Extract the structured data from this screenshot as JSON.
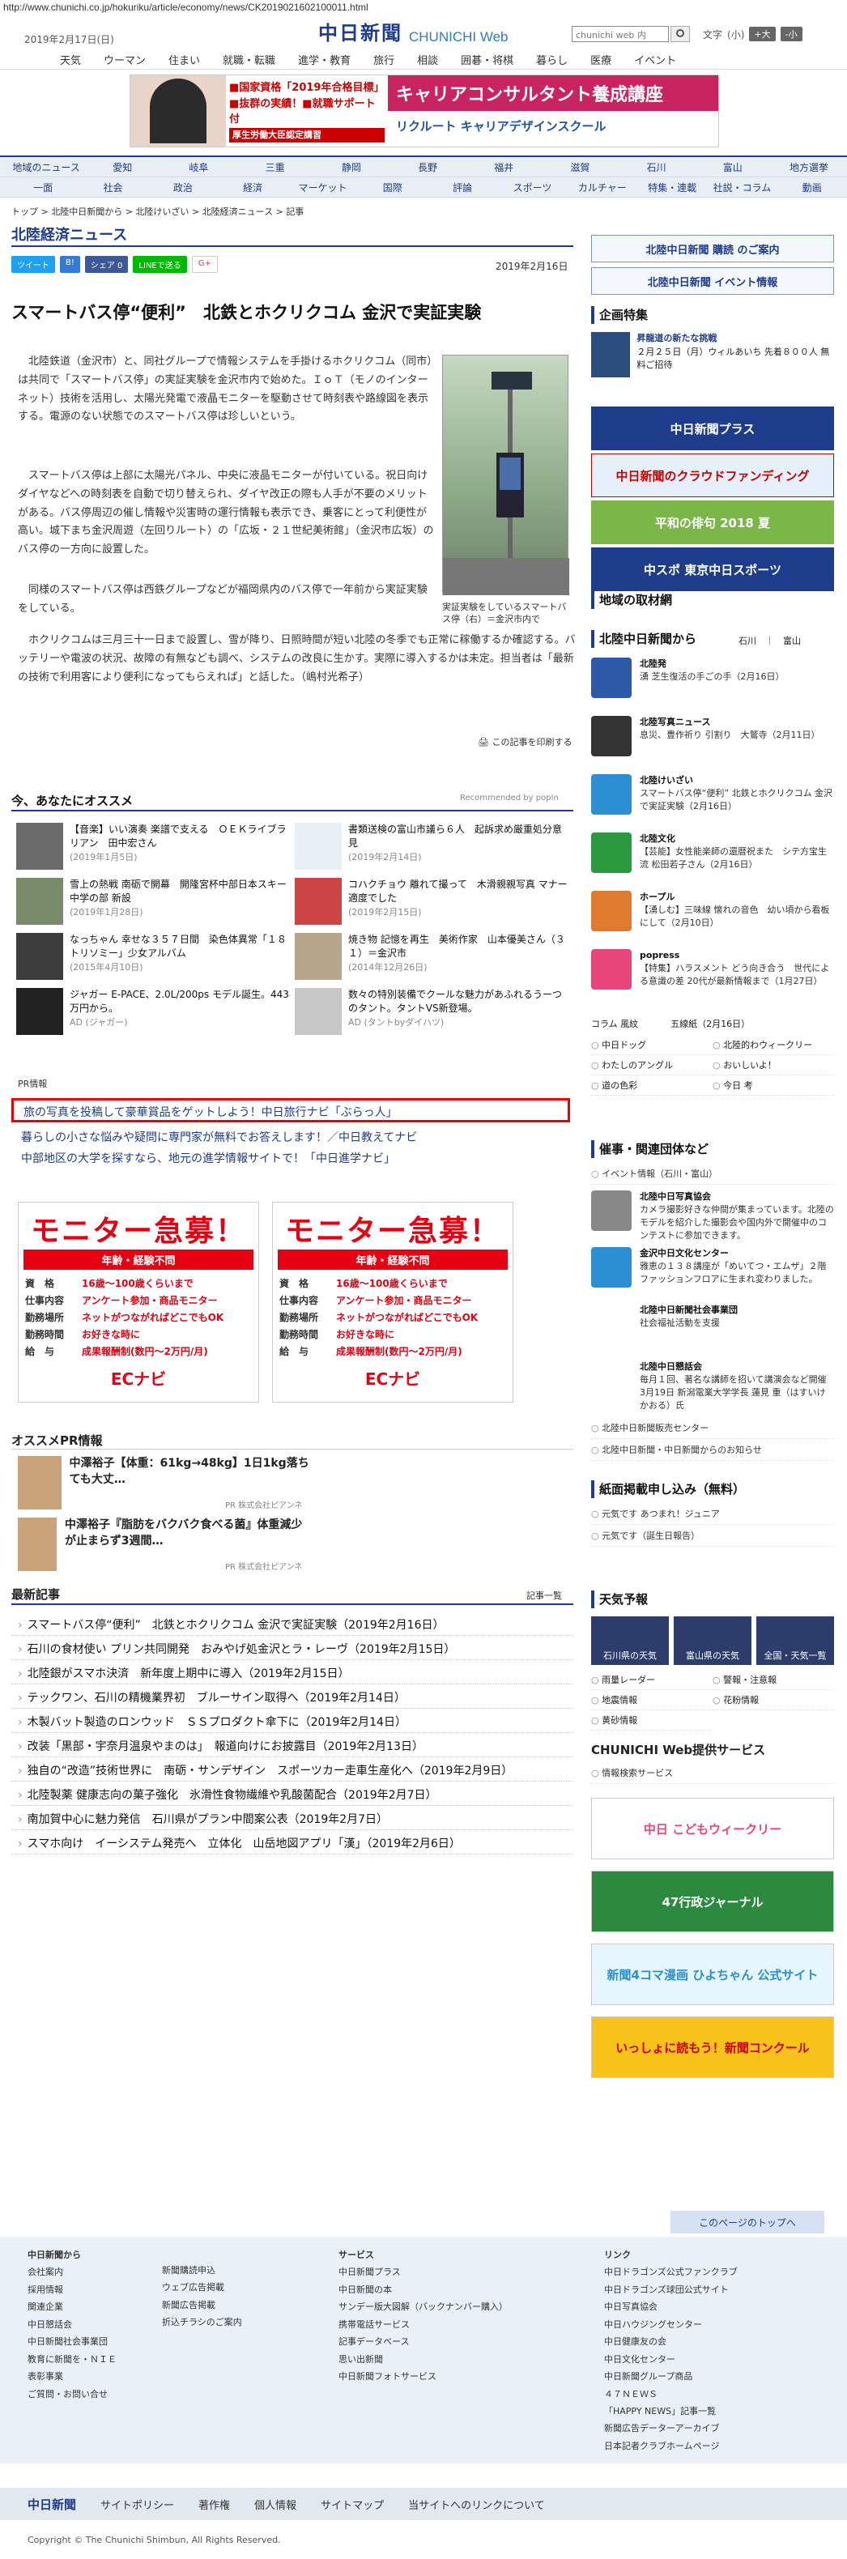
{
  "url": "http://www.chunichi.co.jp/hokuriku/article/economy/news/CK2019021602100011.html",
  "site": {
    "date": "2019年2月17日(日)",
    "logo_jp": "中日新聞",
    "logo_en": "CHUNICHI Web",
    "search_placeholder": "chunichi web 内",
    "font_label": "文字",
    "font_small": "(小)",
    "font_big": "+大",
    "font_minus": "-小"
  },
  "topnav": [
    "天気",
    "ウーマン",
    "住まい",
    "就職・転職",
    "進学・教育",
    "旅行",
    "相談",
    "囲碁・将棋",
    "暮らし",
    "医療",
    "イベント"
  ],
  "ad": {
    "left1": "■国家資格「2019年合格目標」",
    "left2": "■抜群の実績！■就職サポート付",
    "left3": "厚生労働大臣認定講習",
    "right_title": "キャリアコンサルタント養成講座",
    "right_brand": "リクルート キャリアデザインスクール"
  },
  "catnav": {
    "row1": [
      "地域のニュース",
      "愛知",
      "岐阜",
      "三重",
      "静岡",
      "長野",
      "福井",
      "滋賀",
      "石川",
      "富山",
      "地方選挙"
    ],
    "row2": [
      "一面",
      "社会",
      "政治",
      "経済",
      "マーケット",
      "国際",
      "評論",
      "スポーツ",
      "カルチャー",
      "特集・連載",
      "社説・コラム",
      "動画"
    ]
  },
  "breadcrumb": "トップ > 北陸中日新聞から > 北陸けいざい > 北陸経済ニュース > 記事",
  "section_title": "北陸経済ニュース",
  "share": [
    "ツイート",
    "B!",
    "シェア 0",
    "LINEで送る",
    "G+"
  ],
  "article": {
    "date": "2019年2月16日",
    "headline": "スマートバス停“便利”　北鉄とホクリクコム 金沢で実証実験",
    "caption": "実証実験をしているスマートバス停（右）＝金沢市内で",
    "p1": "　北陸鉄道（金沢市）と、同社グループで情報システムを手掛けるホクリクコム（同市）は共同で「スマートバス停」の実証実験を金沢市内で始めた。ＩｏＴ（モノのインターネット）技術を活用し、太陽光発電で液晶モニターを駆動させて時刻表や路線図を表示する。電源のない状態でのスマートバス停は珍しいという。",
    "p2": "　スマートバス停は上部に太陽光パネル、中央に液晶モニターが付いている。祝日向けダイヤなどへの時刻表を自動で切り替えられ、ダイヤ改正の際も人手が不要のメリットがある。バス停周辺の催し情報や災害時の運行情報も表示でき、乗客にとって利便性が高い。城下まち金沢周遊（左回りルート）の「広坂・２１世紀美術館」（金沢市広坂）のバス停の一方向に設置した。",
    "p3": "　同様のスマートバス停は西鉄グループなどが福岡県内のバス停で一年前から実証実験をしている。",
    "p4": "　ホクリクコムは三月三十一日まで設置し、雪が降り、日照時間が短い北陸の冬季でも正常に稼働するか確認する。バッテリーや電波の状況、故障の有無なども調べ、システムの改良に生かす。実際に導入するかは未定。担当者は「最新の技術で利用客により便利になってもらえれば」と話した。（嶋村光希子）",
    "print": "この記事を印刷する"
  },
  "reco": {
    "title": "今、あなたにオススメ",
    "brand": "Recommended by popIn",
    "items": [
      {
        "t": "【音楽】いい演奏 楽譜で支える　ＯＥＫライブラリアン　田中宏さん",
        "s": "(2019年1月5日)"
      },
      {
        "t": "書類送検の富山市議ら６人　起訴求め厳重処分意見",
        "s": "(2019年2月14日)"
      },
      {
        "t": "雪上の熱戦 南砺で開幕　開隆宮杯中部日本スキー 中学の部 新設",
        "s": "(2019年1月28日)"
      },
      {
        "t": "コハクチョウ 離れて撮って　木滑親親写真 マナー適度でした",
        "s": "(2019年2月15日)"
      },
      {
        "t": "なっちゃん 幸せな３５７日間　染色体異常「１８トリソミー」少女アルバム",
        "s": "(2015年4月10日)"
      },
      {
        "t": "焼き物 記憶を再生　美術作家　山本優美さん（３１）＝金沢市",
        "s": "(2014年12月26日)"
      },
      {
        "t": "ジャガー E-PACE、2.0L/200ps モデル誕生。443万円から。",
        "s": "AD (ジャガー)"
      },
      {
        "t": "数々の特別装備でクールな魅力があふれるうーつのタント。タントVS新登場。",
        "s": "AD (タントbyダイハツ)"
      }
    ]
  },
  "pr": {
    "label": "PR情報",
    "boxed": "旅の写真を投稿して豪華賞品をゲットしよう！中日旅行ナビ「ぶらっ人」",
    "l2": "暮らしの小さな悩みや疑問に専門家が無料でお答えします！／中日教えてナビ",
    "l3": "中部地区の大学を探すなら、地元の進学情報サイトで！「中日進学ナビ」"
  },
  "ecad": {
    "title": "モニター急募！",
    "band": "年齢・経験不問",
    "rows": [
      [
        "資　格",
        "16歳～100歳くらいまで"
      ],
      [
        "仕事内容",
        "アンケート参加・商品モニター"
      ],
      [
        "勤務場所",
        "ネットがつながればどこでもOK"
      ],
      [
        "勤務時間",
        "お好きな時に"
      ],
      [
        "給　与",
        "成果報酬制(数円～2万円/月)"
      ]
    ],
    "logo": "ECナビ"
  },
  "osusume": {
    "title": "オススメPR情報",
    "items": [
      {
        "t": "中澤裕子【体重：61kg→48kg】1日1kg落ちても大丈…",
        "src": "PR 株式会社ピアンネ"
      },
      {
        "t": "中澤裕子『脂肪をバクバク食べる菌』体重減少が止まらず3週間…",
        "src": "PR 株式会社ピアンネ"
      }
    ]
  },
  "latest": {
    "title": "最新記事",
    "more": "記事一覧",
    "items": [
      "スマートバス停“便利”　北鉄とホクリクコム 金沢で実証実験（2019年2月16日）",
      "石川の食材使い プリン共同開発　おみやげ処金沢とラ・レーヴ（2019年2月15日）",
      "北陸銀がスマホ決済　新年度上期中に導入（2019年2月15日）",
      "テックワン、石川の精機業界初　ブルーサイン取得へ（2019年2月14日）",
      "木製バット製造のロンウッド　ＳＳプロダクト傘下に（2019年2月14日）",
      "改装「黒部・宇奈月温泉やまのは」　報道向けにお披露目（2019年2月13日）",
      "独自の“改造”技術世界に　南砺・サンデザイン　スポーツカー走車生産化へ（2019年2月9日）",
      "北陸製薬 健康志向の菓子強化　氷滑性食物繊維や乳酸菌配合（2019年2月7日）",
      "南加賀中心に魅力発信　石川県がプラン中間案公表（2019年2月7日）",
      "スマホ向け　イーシステム発売へ　立体化　山岳地図アプリ「漢」（2019年2月6日）"
    ]
  },
  "side": {
    "kodoku": "北陸中日新聞 購読 のご案内",
    "event": "北陸中日新聞 イベント情報",
    "kikaku": "企画特集",
    "kikaku_t": "昇龍道の新たな挑戦",
    "kikaku_s": "２月２５日（月）ウィルあいち 先着８００人 無料ご招待",
    "b1": "中日新聞プラス",
    "b2": "中日新聞のクラウドファンディング",
    "b3": "平和の俳句 2018 夏",
    "b4": "中スポ 東京中日スポーツ",
    "chiiki": "地域の取材網",
    "hokuriku": "北陸中日新聞から",
    "hk_links": "石川　｜　富山",
    "items": [
      {
        "h": "北陸発",
        "t": "湧 芝生復活の手ごの手（2月16日）",
        "c": "#2d5aa8"
      },
      {
        "h": "北陸写真ニュース",
        "t": "息災、豊作祈り 引割り　大鷲寺（2月11日）",
        "c": "#333"
      },
      {
        "h": "北陸けいざい",
        "t": "スマートバス停“便利” 北鉄とホクリクコム 金沢で実証実験（2月16日）",
        "c": "#2a8fd3"
      },
      {
        "h": "北陸文化",
        "t": "【芸能】女性能楽師の還暦祝また　シテ方宝生流 松田若子さん（2月16日）",
        "c": "#2b9a3e"
      },
      {
        "h": "ホープル",
        "t": "【湧しむ】三味線 懐れの音色　幼い頃から看板にして（2月10日）",
        "c": "#e07a2f"
      },
      {
        "h": "popress",
        "t": "【特集】ハラスメント どう向き合う　世代による意識の差 20代が最新情報まで（1月27日）",
        "c": "#e8467a"
      }
    ],
    "col": "コラム 風紋",
    "col2": "五線紙（2月16日）",
    "links": [
      "中日ドッグ",
      "北陸的わウィークリー",
      "わたしのアングル",
      "おいしいよ！",
      "道の色彩",
      "今日 考"
    ],
    "saiji": "催事・関連団体など",
    "saiji_ev": "イベント情報（石川・富山）",
    "saiji_items": [
      {
        "h": "北陸中日写真協会",
        "t": "カメラ撮影好きな仲間が集まっています。北陸のモデルを紹介した撮影会や国内外で開催中のコンテストに参加できます。"
      },
      {
        "h": "金沢中日文化センター",
        "t": "雅恵の１３８講座が「めいてつ・エムザ」２階ファッションフロアに生まれ変わりました。"
      },
      {
        "h": "北陸中日新聞社会事業団",
        "t": "社会福祉活動を支援"
      },
      {
        "h": "北陸中日懇話会",
        "t": "毎月１回、著名な講師を招いて講演会など開催 3月19日 新潟電業大学学長 蓮見 重（はすいけ かおる）氏"
      }
    ],
    "saiji_links": [
      "北陸中日新聞販売センター",
      "北陸中日新聞・中日新聞からのお知らせ"
    ],
    "shimen": "紙面掲載申し込み（無料）",
    "shimen_links": [
      "元気です あつまれ！ジュニア",
      "元気です（誕生日報告）"
    ],
    "tenki": "天気予報",
    "tenki_items": [
      "石川県の天気",
      "富山県の天気",
      "全国・天気一覧"
    ],
    "tenki_links": [
      "雨量レーダー",
      "警報・注意報",
      "地震情報",
      "花粉情報",
      "黄砂情報"
    ],
    "service": "CHUNICHI Web提供サービス",
    "service_link": "情報検索サービス",
    "banners": [
      "中日 こどもウィークリー",
      "47行政ジャーナル",
      "新聞4コマ漫画 ひよちゃん 公式サイト",
      "いっしょに読もう！新聞コンクール"
    ]
  },
  "footer": {
    "totop": "このページのトップへ",
    "c1h": "中日新聞から",
    "c1": [
      "会社案内",
      "採用情報",
      "関連企業",
      "中日懇話会",
      "中日新聞社会事業団",
      "教育に新聞を・ＮＩＥ",
      "表彰事業",
      "ご質問・お問い合せ"
    ],
    "c2": [
      "新聞購読申込",
      "ウェブ広告掲載",
      "新聞広告掲載",
      "折込チラシのご案内"
    ],
    "c3h": "サービス",
    "c3": [
      "中日新聞プラス",
      "中日新聞の本",
      "サンデー版大図解（バックナンバー購入）",
      "携帯電話サービス",
      "記事データベース",
      "思い出新聞",
      "中日新聞フォトサービス"
    ],
    "c4h": "リンク",
    "c4": [
      "中日ドラゴンズ公式ファンクラブ",
      "中日ドラゴンズ球団公式サイト",
      "中日写真協会",
      "中日ハウジングセンター",
      "中日健康友の会",
      "中日文化センター",
      "中日新聞グループ商品",
      "４７ＮＥＷＳ",
      "「HAPPY NEWS」記事一覧",
      "新聞広告データーアーカイブ",
      "日本記者クラブホームページ"
    ],
    "bar": [
      "中日新聞",
      "サイトポリシー",
      "著作権",
      "個人情報",
      "サイトマップ",
      "当サイトへのリンクについて"
    ],
    "copy": "Copyright © The Chunichi Shimbun, All Rights Reserved."
  }
}
